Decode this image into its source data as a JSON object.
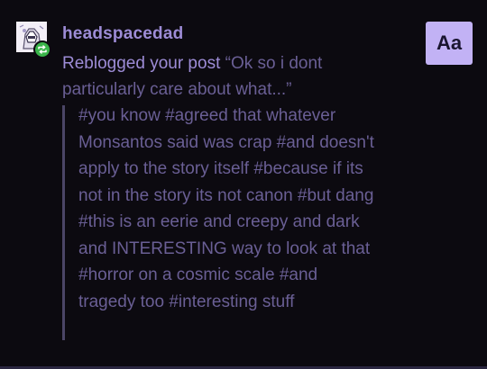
{
  "notification": {
    "username": "headspacedad",
    "action_text": "Reblogged your post",
    "post_excerpt": "“Ok so i dont particularly care about what...”",
    "tags_text": "#you know #agreed that whatever Monsantos said was crap #and doesn't apply to the story itself #because if its not in the story its not canon #but dang #this is an eerie and creepy and dark and INTERESTING way to look at that #horror on a cosmic scale #and tragedy too #interesting stuff"
  },
  "toolbar": {
    "text_button_label": "Aa"
  },
  "icons": {
    "avatar": "avatar-icon",
    "reblog": "reblog-icon"
  },
  "colors": {
    "background": "#0c0a10",
    "username": "#9d8cd6",
    "muted_text": "#6a5f95",
    "accent_button": "#c2b2f5",
    "reblog_badge": "#3ab54a"
  }
}
